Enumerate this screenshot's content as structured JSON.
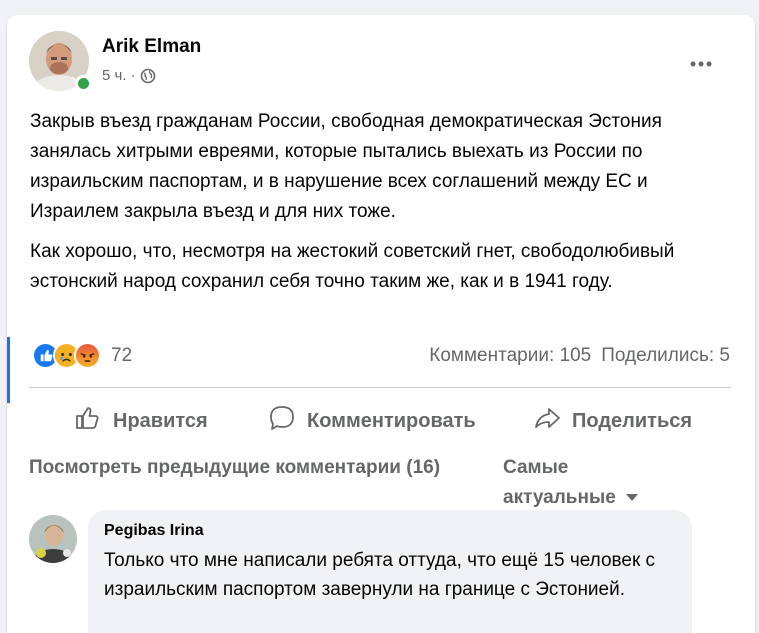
{
  "post": {
    "author": "Arik Elman",
    "time": "5 ч.",
    "separator": "·",
    "paragraphs": [
      "Закрыв въезд гражданам России, свободная демократическая Эстония занялась хитрыми евреями, которые пытались выехать из России по израильским паспортам, и в нарушение всех соглашений между ЕС и Израилем закрыла въезд и для них тоже.",
      "Как хорошо, что, несмотря на жестокий советский гнет, свободолюбивый эстонский народ сохранил себя точно таким же, как и в 1941 году."
    ],
    "reactions": {
      "icons": [
        "like-icon",
        "sad-icon",
        "angry-icon"
      ],
      "count": "72"
    },
    "comments_count": "Комментарии: 105",
    "shares_count": "Поделились: 5"
  },
  "actions": {
    "like": "Нравится",
    "comment": "Комментировать",
    "share": "Поделиться"
  },
  "comments_section": {
    "view_previous": "Посмотреть предыдущие комментарии (16)",
    "sort": "Самые актуальные",
    "comments": [
      {
        "author": "Pegibas Irina",
        "text": "Только что мне написали ребята оттуда, что ещё 15 человек с израильским паспортом завернули на границе с Эстонией."
      }
    ]
  },
  "colors": {
    "accent": "#1b74e4",
    "secondary_text": "#65676b",
    "online": "#31a24c"
  }
}
